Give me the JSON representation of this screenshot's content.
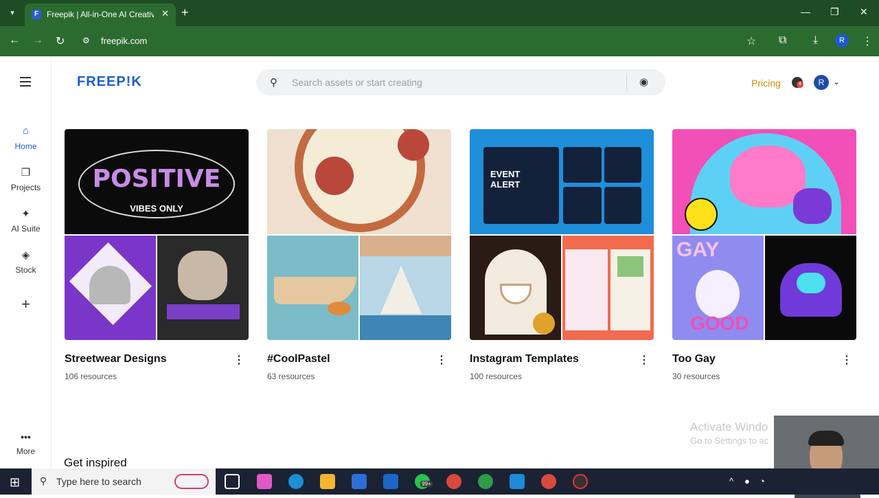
{
  "browser": {
    "tab_title": "Freepik | All-in-One AI Creative",
    "tab_close": "✕",
    "new_tab": "+",
    "url": "freepik.com",
    "window_controls": [
      "—",
      "❐",
      "✕"
    ],
    "profile_initial": "R"
  },
  "header": {
    "logo": "FREEP!K",
    "search_placeholder": "Search assets or start creating",
    "pricing_label": "Pricing",
    "notification_count": "4",
    "avatar_initial": "R"
  },
  "sidebar": {
    "items": [
      {
        "label": "Home",
        "icon": "home-icon"
      },
      {
        "label": "Projects",
        "icon": "projects-icon"
      },
      {
        "label": "AI Suite",
        "icon": "sparkle-icon"
      },
      {
        "label": "Stock",
        "icon": "stock-icon"
      }
    ],
    "add": "+",
    "more_label": "More",
    "more_icon": "•••"
  },
  "collections": [
    {
      "title": "Streetwear Designs",
      "resources": "106 resources"
    },
    {
      "title": "#CoolPastel",
      "resources": "63 resources"
    },
    {
      "title": "Instagram Templates",
      "resources": "100 resources"
    },
    {
      "title": "Too Gay",
      "resources": "30 resources"
    }
  ],
  "thumb_text": {
    "streetwear_top": "POSITIVE",
    "streetwear_sub": "VIBES ONLY",
    "insta_event": "EVENT ALERT",
    "toogay_gay": "GAY",
    "toogay_good": "GOOD"
  },
  "section_title": "Get inspired",
  "watermark": {
    "line1": "Activate Windo",
    "line2": "Go to Settings to ac"
  },
  "taskbar": {
    "search_text": "Type here to search",
    "whatsapp_badge": "99+"
  },
  "colors": {
    "brand": "#1d5fd1",
    "pricing": "#d68a00",
    "chrome": "#2b6b2f"
  }
}
